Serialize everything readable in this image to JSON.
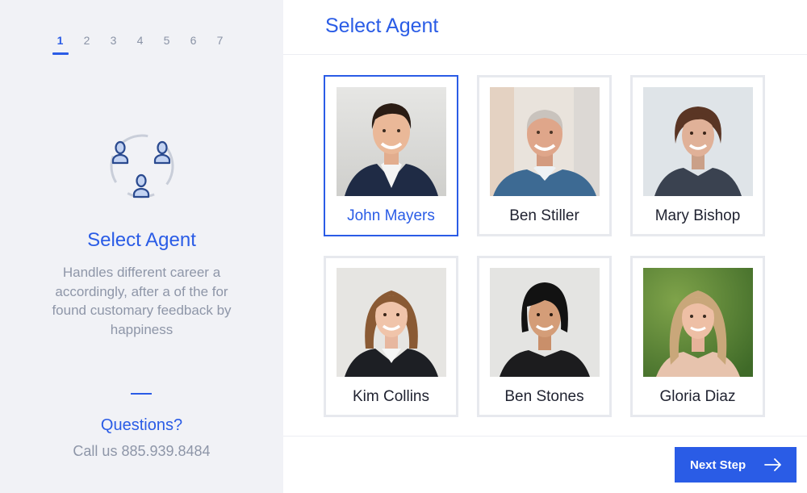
{
  "steps": [
    "1",
    "2",
    "3",
    "4",
    "5",
    "6",
    "7"
  ],
  "active_step": 1,
  "sidebar": {
    "title": "Select Agent",
    "description": "Handles different career a accordingly, after a of the for found customary feedback by happiness",
    "questions_label": "Questions?",
    "phone_text": "Call us 885.939.8484"
  },
  "main": {
    "title": "Select Agent",
    "agents": [
      {
        "name": "John Mayers",
        "selected": true
      },
      {
        "name": "Ben Stiller",
        "selected": false
      },
      {
        "name": "Mary Bishop",
        "selected": false
      },
      {
        "name": "Kim Collins",
        "selected": false
      },
      {
        "name": "Ben Stones",
        "selected": false
      },
      {
        "name": "Gloria Diaz",
        "selected": false
      }
    ],
    "next_label": "Next Step"
  },
  "colors": {
    "accent": "#2a5ce6",
    "sidebar_bg": "#f1f2f6",
    "muted_text": "#8e96a8",
    "card_border": "#e7e9ee"
  },
  "icons": {
    "sidebar": "agents-group-icon",
    "next": "arrow-right-icon"
  }
}
